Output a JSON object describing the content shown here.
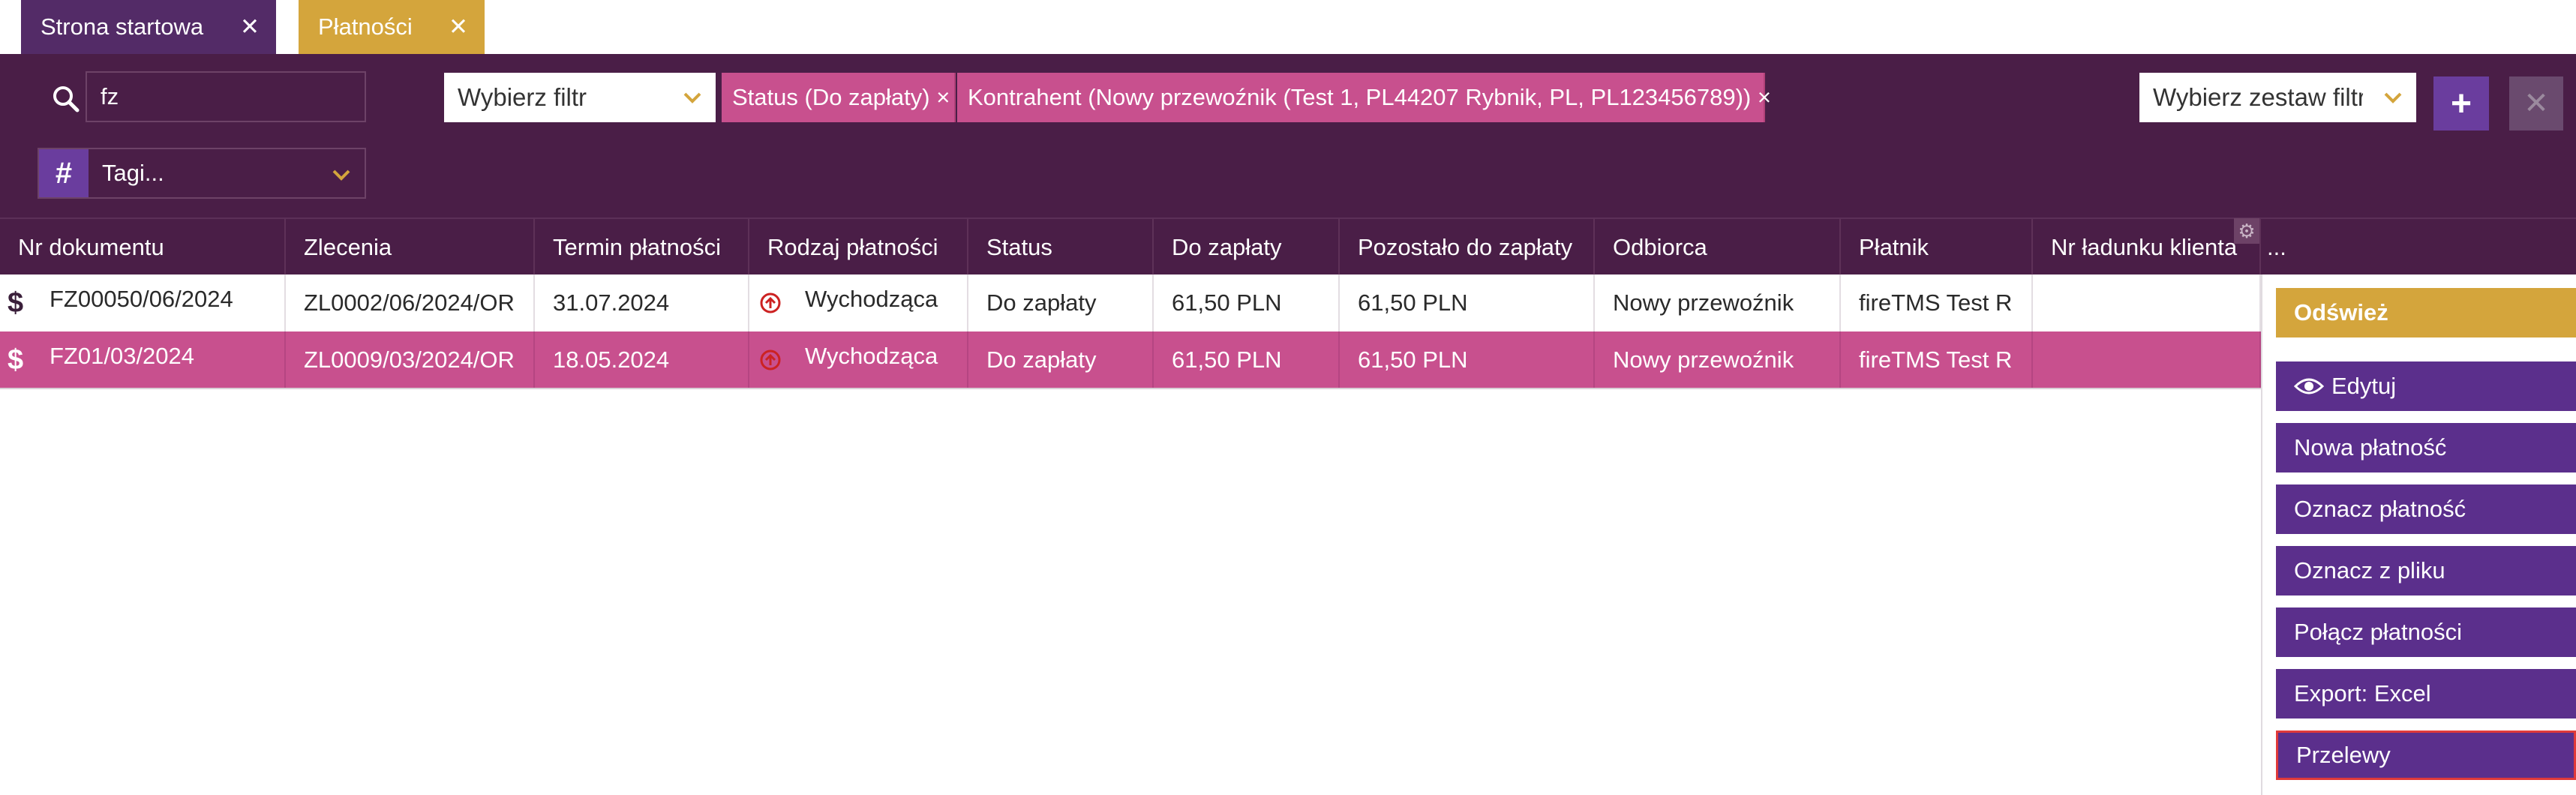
{
  "tabs": [
    {
      "label": "Strona startowa",
      "close": "✕"
    },
    {
      "label": "Płatności",
      "close": "✕"
    }
  ],
  "filters": {
    "search_value": "fz",
    "filter_select": "Wybierz filtr",
    "chips": [
      "Status (Do zapłaty) ×",
      "Kontrahent (Nowy przewoźnik (Test 1, PL44207 Rybnik, PL, PL123456789)) ×"
    ],
    "set_select": "Wybierz zestaw filtrów",
    "add_label": "+",
    "clear_label": "✕",
    "tags_label": "Tagi...",
    "tags_hash": "#"
  },
  "table": {
    "columns": [
      "Nr dokumentu",
      "Zlecenia",
      "Termin płatności",
      "Rodzaj płatności",
      "Status",
      "Do zapłaty",
      "Pozostało do zapłaty",
      "Odbiorca",
      "Płatnik",
      "Nr ładunku klienta",
      "..."
    ],
    "rows": [
      {
        "icon": "$",
        "doc": "FZ00050/06/2024",
        "order": "ZL0002/06/2024/OR",
        "due": "31.07.2024",
        "type": "Wychodząca",
        "status": "Do zapłaty",
        "amount": "61,50 PLN",
        "remaining": "61,50 PLN",
        "recipient": "Nowy przewoźnik",
        "payer": "fireTMS Test R",
        "cargo": ""
      },
      {
        "icon": "$",
        "doc": "FZ01/03/2024",
        "order": "ZL0009/03/2024/OR",
        "due": "18.05.2024",
        "type": "Wychodząca",
        "status": "Do zapłaty",
        "amount": "61,50 PLN",
        "remaining": "61,50 PLN",
        "recipient": "Nowy przewoźnik",
        "payer": "fireTMS Test R",
        "cargo": ""
      }
    ]
  },
  "actions": {
    "refresh": "Odśwież",
    "edit": "Edytuj",
    "new_payment": "Nowa płatność",
    "mark_payment": "Oznacz płatność",
    "mark_from_file": "Oznacz z pliku",
    "merge_payments": "Połącz płatności",
    "export_excel": "Export: Excel",
    "transfers": "Przelewy"
  },
  "colors": {
    "header_bg": "#4a1e47",
    "tab_active": "#d4a53c",
    "tab_inactive": "#532b67",
    "selected_row": "#c8508e",
    "action_button": "#5b2f8c",
    "refresh_button": "#d4a53c"
  }
}
